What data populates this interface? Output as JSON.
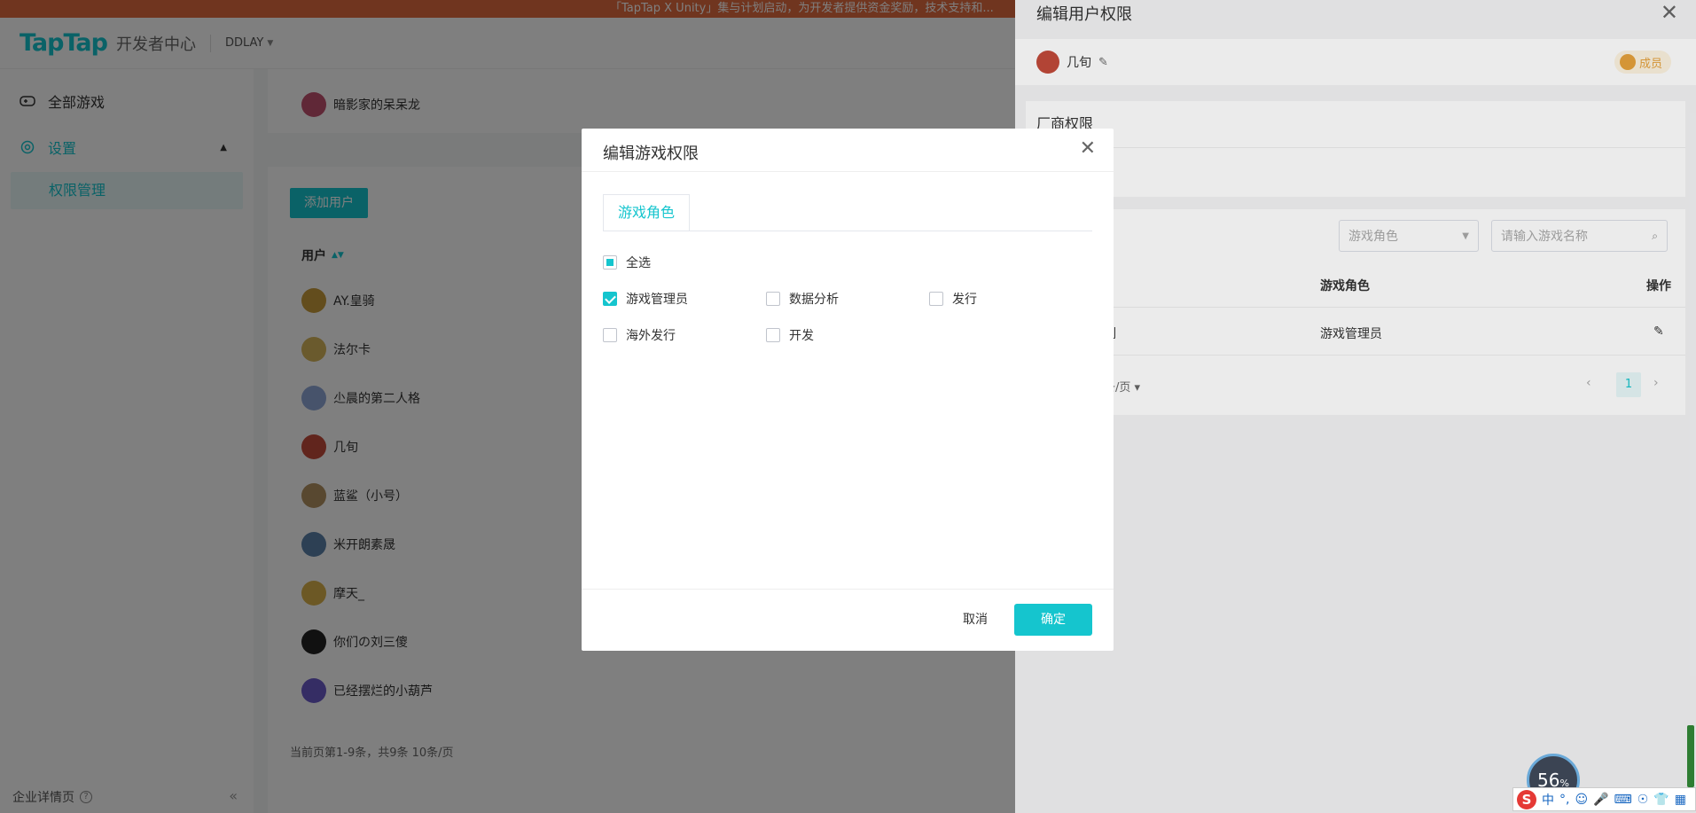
{
  "banner": {
    "text": "「TapTap X Unity」集与计划启动，为开发者提供资金奖励，技术支持和..."
  },
  "header": {
    "logo": "TapTap",
    "subtitle": "开发者中心",
    "org": "DDLAY"
  },
  "sidebar": {
    "items": [
      {
        "label": "全部游戏"
      },
      {
        "label": "设置"
      }
    ],
    "sub_item": "权限管理",
    "footer": "企业详情页"
  },
  "main": {
    "users_top": [
      "暗影家的呆呆龙"
    ],
    "add_user": "添加用户",
    "col_user": "用户",
    "users": [
      "AY.皇骑",
      "法尔卡",
      "尐晨的第二人格",
      "几旬",
      "蓝鲨（小号）",
      "米开朗素晟",
      "摩天_",
      "你们の刘三傻",
      "已经摆烂的小葫芦"
    ],
    "pager": "当前页第1-9条，共9条  10条/页"
  },
  "drawer": {
    "title": "编辑用户权限",
    "user_name": "几旬",
    "role": "成员",
    "section_label": "厂商权限",
    "filter_role_placeholder": "游戏角色",
    "search_placeholder": "请输入游戏名称",
    "th_role": "游戏角色",
    "th_action": "操作",
    "row_game": "刻",
    "row_role": "游戏管理员",
    "page_size": "条/页",
    "page": "1"
  },
  "modal": {
    "title": "编辑游戏权限",
    "tab": "游戏角色",
    "select_all": "全选",
    "options": [
      {
        "label": "游戏管理员",
        "checked": true
      },
      {
        "label": "数据分析",
        "checked": false
      },
      {
        "label": "发行",
        "checked": false
      },
      {
        "label": "海外发行",
        "checked": false
      },
      {
        "label": "开发",
        "checked": false
      }
    ],
    "cancel": "取消",
    "ok": "确定"
  },
  "system": {
    "perf": "56",
    "perf_unit": "%",
    "ime_mode": "中"
  },
  "colors": {
    "accent": "#15c5ce",
    "banner": "#e06a3f",
    "badge": "#e6a23c"
  }
}
